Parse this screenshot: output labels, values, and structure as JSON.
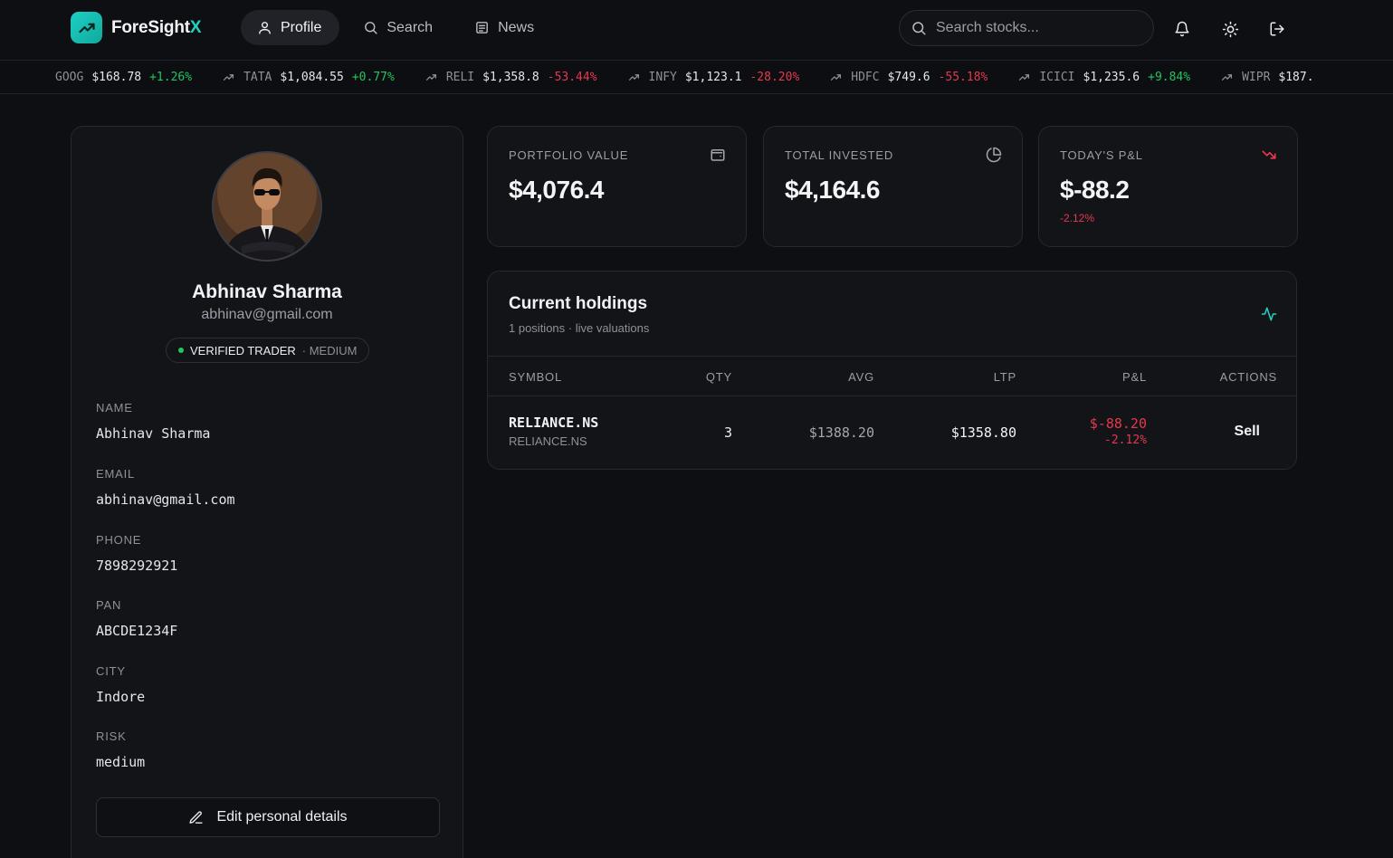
{
  "brand": {
    "name_main": "ForeSight",
    "name_accent": "X"
  },
  "nav": {
    "items": [
      {
        "label": "Profile",
        "icon": "user-icon",
        "active": true
      },
      {
        "label": "Search",
        "icon": "search-icon",
        "active": false
      },
      {
        "label": "News",
        "icon": "newspaper-icon",
        "active": false
      }
    ],
    "search_placeholder": "Search stocks..."
  },
  "ticker": [
    {
      "symbol": "GOOG",
      "price": "$168.78",
      "change": "+1.26%",
      "direction": "up"
    },
    {
      "symbol": "TATA",
      "price": "$1,084.55",
      "change": "+0.77%",
      "direction": "up"
    },
    {
      "symbol": "RELI",
      "price": "$1,358.8",
      "change": "-53.44%",
      "direction": "down"
    },
    {
      "symbol": "INFY",
      "price": "$1,123.1",
      "change": "-28.20%",
      "direction": "down"
    },
    {
      "symbol": "HDFC",
      "price": "$749.6",
      "change": "-55.18%",
      "direction": "down"
    },
    {
      "symbol": "ICICI",
      "price": "$1,235.6",
      "change": "+9.84%",
      "direction": "up"
    },
    {
      "symbol": "WIPR",
      "price": "$187.",
      "change": "",
      "direction": "up"
    }
  ],
  "profile": {
    "name": "Abhinav Sharma",
    "email": "abhinav@gmail.com",
    "badge_main": "VERIFIED TRADER",
    "badge_sub": "· MEDIUM",
    "fields": [
      {
        "label": "NAME",
        "value": "Abhinav Sharma"
      },
      {
        "label": "EMAIL",
        "value": "abhinav@gmail.com"
      },
      {
        "label": "PHONE",
        "value": "7898292921"
      },
      {
        "label": "PAN",
        "value": "ABCDE1234F"
      },
      {
        "label": "CITY",
        "value": "Indore"
      },
      {
        "label": "RISK",
        "value": "medium"
      }
    ],
    "edit_label": "Edit personal details"
  },
  "stats": [
    {
      "label": "PORTFOLIO VALUE",
      "value": "$4,076.4",
      "sub": "",
      "icon": "wallet-icon"
    },
    {
      "label": "TOTAL INVESTED",
      "value": "$4,164.6",
      "sub": "",
      "icon": "pie-chart-icon"
    },
    {
      "label": "TODAY'S P&L",
      "value": "$-88.2",
      "sub": "-2.12%",
      "icon": "trending-down-icon"
    }
  ],
  "holdings": {
    "title": "Current holdings",
    "subtitle": "1 positions · live valuations",
    "columns": [
      "SYMBOL",
      "QTY",
      "AVG",
      "LTP",
      "P&L",
      "ACTIONS"
    ],
    "rows": [
      {
        "symbol": "RELIANCE.NS",
        "symbol_sub": "RELIANCE.NS",
        "qty": "3",
        "avg": "$1388.20",
        "ltp": "$1358.80",
        "pnl": "$-88.20",
        "pnl_pct": "-2.12%",
        "action": "Sell"
      }
    ]
  },
  "colors": {
    "accent": "#1fd1c2",
    "up": "#22c55e",
    "down": "#e5384f",
    "background": "#0e0f12",
    "card": "#131418"
  }
}
